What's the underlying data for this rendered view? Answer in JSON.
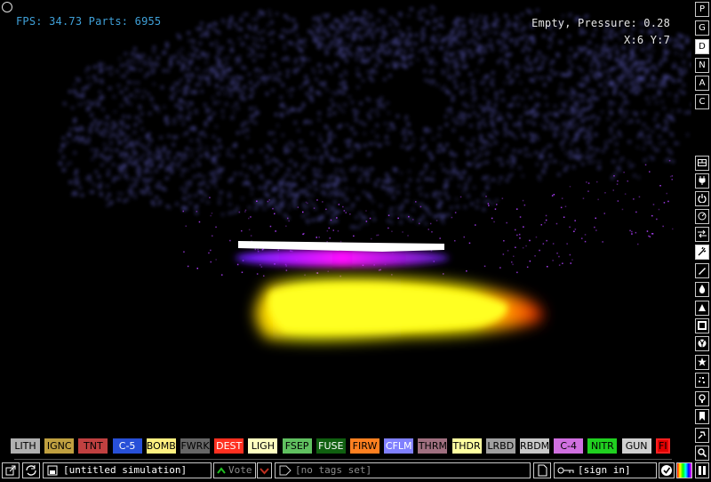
{
  "hud": {
    "fps_text": "FPS: 34.73 Parts: 6955",
    "hover_text": "Empty, Pressure: 0.28",
    "coords_text": "X:6 Y:7"
  },
  "menu_buttons": [
    "P",
    "G",
    "D",
    "N",
    "A",
    "C"
  ],
  "category_icons": [
    "wall-icon",
    "electronics-icon",
    "power-icon",
    "force-icon",
    "sensor-icon",
    "explosives-icon",
    "gas-icon",
    "liquid-icon",
    "powder-icon",
    "solid-icon",
    "radioactive-icon",
    "special-icon",
    "particles-icon",
    "life-icon",
    "tools-icon",
    "favorites-icon",
    "search-icon"
  ],
  "elements": [
    {
      "label": "LITH",
      "bg": "#b0b0b0",
      "fg": "#000"
    },
    {
      "label": "IGNC",
      "bg": "#c0a040",
      "fg": "#000"
    },
    {
      "label": "TNT",
      "bg": "#c04040",
      "fg": "#000"
    },
    {
      "label": "C-5",
      "bg": "#2850d8",
      "fg": "#fff"
    },
    {
      "label": "BOMB",
      "bg": "#fff080",
      "fg": "#000"
    },
    {
      "label": "FWRK",
      "bg": "#666666",
      "fg": "#000"
    },
    {
      "label": "DEST",
      "bg": "#ff3020",
      "fg": "#fff"
    },
    {
      "label": "LIGH",
      "bg": "#ffffc0",
      "fg": "#000"
    },
    {
      "label": "FSEP",
      "bg": "#60c060",
      "fg": "#000"
    },
    {
      "label": "FUSE",
      "bg": "#106010",
      "fg": "#fff"
    },
    {
      "label": "FIRW",
      "bg": "#ff8020",
      "fg": "#000"
    },
    {
      "label": "CFLM",
      "bg": "#8080ff",
      "fg": "#fff"
    },
    {
      "label": "THRM",
      "bg": "#a07080",
      "fg": "#000"
    },
    {
      "label": "THDR",
      "bg": "#ffffa0",
      "fg": "#000"
    },
    {
      "label": "LRBD",
      "bg": "#a0a0a0",
      "fg": "#000"
    },
    {
      "label": "RBDM",
      "bg": "#c8c8c8",
      "fg": "#000"
    },
    {
      "label": "C-4",
      "bg": "#d070e0",
      "fg": "#000"
    },
    {
      "label": "NITR",
      "bg": "#20d020",
      "fg": "#000"
    },
    {
      "label": "GUN",
      "bg": "#d0d0d0",
      "fg": "#000"
    },
    {
      "label": "FI",
      "bg": "#e00000",
      "fg": "#000"
    }
  ],
  "bottom_bar": {
    "title": "[untitled simulation]",
    "vote_label": "Vote",
    "tags_label": "[no tags set]",
    "signin_label": "[sign in]"
  },
  "colors": {
    "smoke": "#5a5ab8",
    "fire_core": "#ffff00",
    "plasma": "#ff20ff",
    "hud_blue": "#3fa0d8",
    "vote_green": "#20c020",
    "vote_red": "#c03020"
  }
}
